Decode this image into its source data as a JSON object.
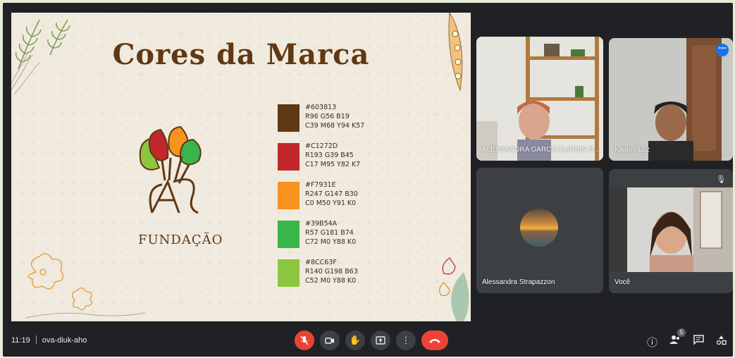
{
  "slide": {
    "title": "Cores da Marca",
    "logo_text": "FUNDAÇÃO",
    "colors": [
      {
        "hex": "#603813",
        "line1": "#603813",
        "line2": "R96 G56 B19",
        "line3": "C39 M68 Y94 K57"
      },
      {
        "hex": "#C1272D",
        "line1": "#C1272D",
        "line2": "R193 G39 B45",
        "line3": "C17 M95 Y82 K7"
      },
      {
        "hex": "#F7931E",
        "line1": "#F7931E",
        "line2": "R247 G147 B30",
        "line3": "C0 M50 Y91 K0"
      },
      {
        "hex": "#39B54A",
        "line1": "#39B54A",
        "line2": "R57 G181 B74",
        "line3": "C72 M0 Y88 K0"
      },
      {
        "hex": "#8CC63F",
        "line1": "#8CC63F",
        "line2": "R140 G198 B63",
        "line3": "C52 M0 Y88 K0"
      }
    ]
  },
  "participants": [
    {
      "name": "ALESSANDRA GARCIA GARBIN S..."
    },
    {
      "name": "Kaiane Luz"
    },
    {
      "name": "Alessandra Strapazzon"
    },
    {
      "name": "Você"
    }
  ],
  "bottombar": {
    "time": "11:19",
    "meeting_code": "ova-diuk-aho",
    "people_count": "5"
  },
  "icons": {
    "mic_off": "mic-off-icon",
    "camera": "camera-icon",
    "raise_hand": "raise-hand-icon",
    "present": "present-screen-icon",
    "more": "more-options-icon",
    "leave": "leave-call-icon",
    "info": "info-icon",
    "people": "people-icon",
    "chat": "chat-icon",
    "activities": "activities-icon"
  },
  "colors": {
    "accent": "#8ab4f8",
    "end_call": "#ea4335",
    "tile_bg": "#3c4043",
    "frame_bg": "#202124"
  }
}
